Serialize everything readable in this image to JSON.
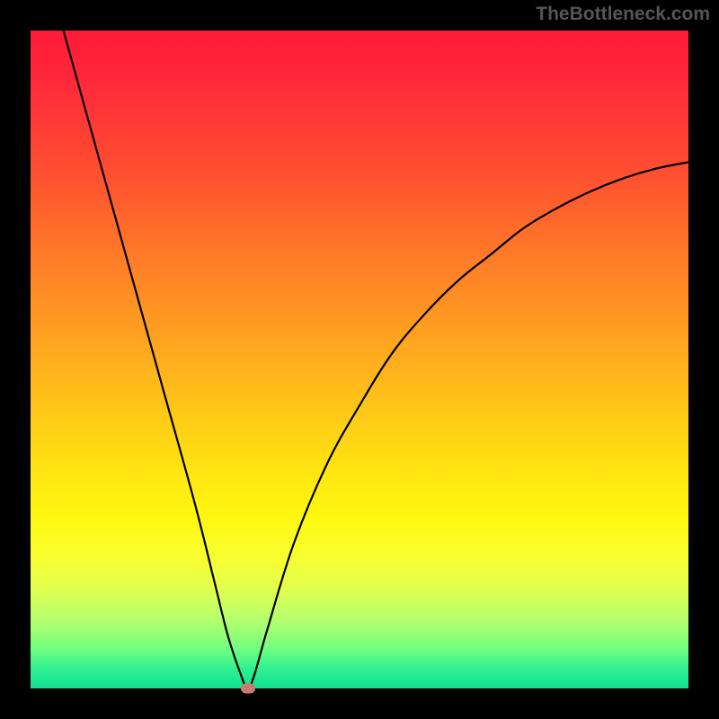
{
  "attribution": "TheBottleneck.com",
  "chart_data": {
    "type": "line",
    "title": "",
    "xlabel": "",
    "ylabel": "",
    "xlim": [
      0,
      100
    ],
    "ylim": [
      0,
      100
    ],
    "background_gradient": {
      "top": "#ff1a3a",
      "bottom": "#10e090",
      "description": "red-orange-yellow-green vertical gradient"
    },
    "series": [
      {
        "name": "bottleneck-curve",
        "color": "#000000",
        "x": [
          5,
          10,
          15,
          20,
          25,
          28,
          30,
          32,
          33,
          34,
          36,
          40,
          45,
          50,
          55,
          60,
          65,
          70,
          75,
          80,
          85,
          90,
          95,
          100
        ],
        "y": [
          100,
          82,
          64,
          46,
          28,
          16,
          8,
          2,
          0,
          2,
          9,
          22,
          34,
          43,
          51,
          57,
          62,
          66,
          70,
          73,
          75.5,
          77.5,
          79,
          80
        ]
      }
    ],
    "marker": {
      "name": "optimal-point",
      "x": 33,
      "y": 0,
      "color": "#cc7a70"
    }
  }
}
